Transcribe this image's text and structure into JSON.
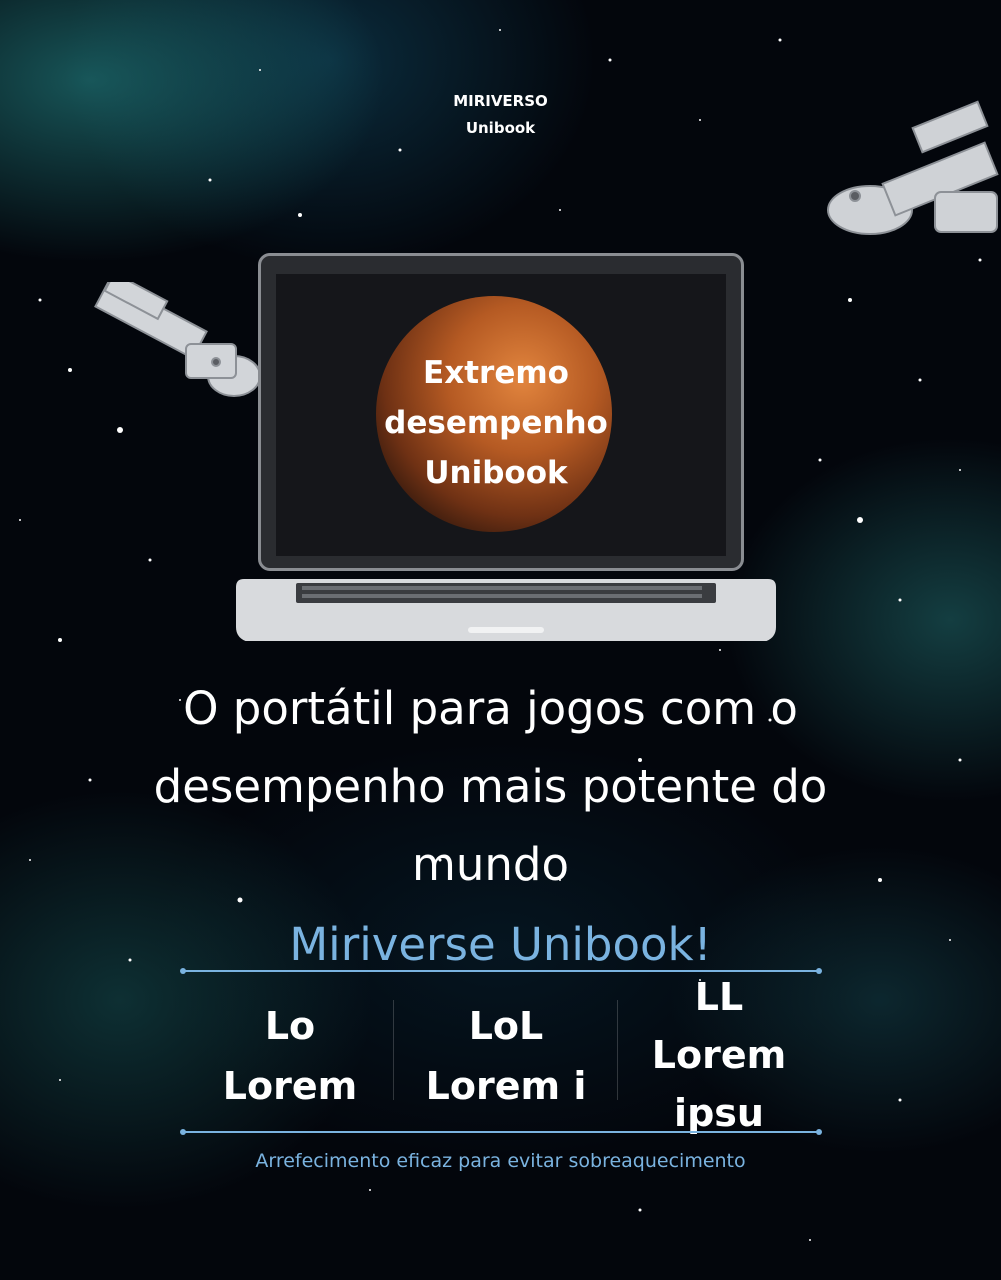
{
  "brand": {
    "line1": "MIRIVERSO",
    "line2": "Unibook"
  },
  "laptop_screen": {
    "line1": "Extremo",
    "line2": "desempenho",
    "line3": "Unibook"
  },
  "headline": {
    "line1": "O portátil para jogos com o",
    "line2": "desempenho mais potente do",
    "line3": "mundo"
  },
  "subheadline": "Miriverse Unibook!",
  "stats": [
    {
      "line1": "Lo",
      "line2": "Lorem"
    },
    {
      "line1": "LoL",
      "line2": "Lorem i"
    },
    {
      "line1": "LL",
      "line2": "Lorem",
      "line3": "ipsu"
    }
  ],
  "footer": "Arrefecimento eficaz para evitar sobreaquecimento",
  "colors": {
    "accent": "#7ab3e0",
    "text": "#ffffff",
    "background": "#03060c"
  }
}
